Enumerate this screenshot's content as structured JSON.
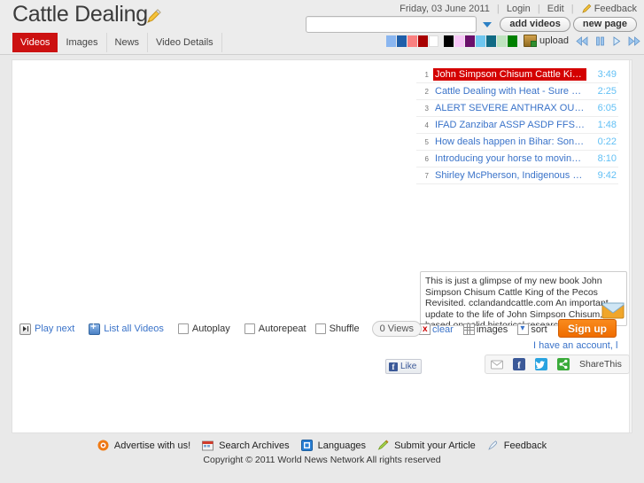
{
  "header": {
    "title": "Cattle Dealing",
    "edit_icon": "pencil-icon",
    "date": "Friday, 03 June 2011",
    "login": "Login",
    "edit": "Edit",
    "feedback": "Feedback",
    "search_value": "",
    "search_placeholder": "",
    "dropdown_icon": "chevron-down-icon",
    "add_videos": "add videos",
    "new_page": "new page"
  },
  "tabs": [
    {
      "label": "Videos",
      "active": true
    },
    {
      "label": "Images",
      "active": false
    },
    {
      "label": "News",
      "active": false
    },
    {
      "label": "Video Details",
      "active": false
    }
  ],
  "toolbar": {
    "swatches": [
      "#8ab6f0",
      "#1f5fa9",
      "#f98080",
      "#a80000",
      "#ffffff",
      "#000000",
      "#f7c7f7",
      "#6b0f6b",
      "#6ec6ef",
      "#116b85",
      "#bfe3bf",
      "#008000"
    ],
    "upload_label": "upload",
    "upload_icon": "upload-icon",
    "controls": [
      {
        "name": "rewind-icon",
        "glyph": "◀◀"
      },
      {
        "name": "pause-icon",
        "glyph": "▐▐"
      },
      {
        "name": "play-icon",
        "glyph": "▶"
      },
      {
        "name": "fast-forward-icon",
        "glyph": "▶▶"
      }
    ]
  },
  "playlist": [
    {
      "num": "1",
      "title": "John Simpson Chisum Cattle King o...",
      "duration": "3:49",
      "active": true
    },
    {
      "num": "2",
      "title": "Cattle Dealing with Heat - Sure Chi...",
      "duration": "2:25",
      "active": false
    },
    {
      "num": "3",
      "title": "ALERT SEVERE ANTHRAX OUTBREAK...",
      "duration": "6:05",
      "active": false
    },
    {
      "num": "4",
      "title": "IFAD Zanzibar ASSP ASDP FFS cattl...",
      "duration": "1:48",
      "active": false
    },
    {
      "num": "5",
      "title": "How deals happen in Bihar: Sonep...",
      "duration": "0:22",
      "active": false
    },
    {
      "num": "6",
      "title": "Introducing your horse to moving c...",
      "duration": "8:10",
      "active": false
    },
    {
      "num": "7",
      "title": "Shirley McPherson, Indigenous Lar...",
      "duration": "9:42",
      "active": false
    }
  ],
  "description": {
    "text": "This is just a glimpse of my new book John Simpson Chisum Cattle King of the Pecos Revisited. cclandandcattle.com An important update to the life of John Simpson Chisum, based on solid historical research and dealing with people and events",
    "envelope_icon": "envelope-icon"
  },
  "meta_row": {
    "clear": "clear",
    "images": "images",
    "sort": "sort"
  },
  "signup": {
    "button": "Sign up",
    "have_account": "I have an account, l"
  },
  "controls": {
    "play_next": "Play next",
    "list_all": "List all Videos",
    "autoplay": "Autoplay",
    "autorepeat": "Autorepeat",
    "shuffle": "Shuffle",
    "views": "0 Views"
  },
  "social": {
    "like": "Like",
    "share_this": "ShareThis",
    "icons": [
      "email-icon",
      "facebook-icon",
      "twitter-icon",
      "sharethis-icon"
    ]
  },
  "footer": {
    "links": [
      {
        "label": "Advertise with us!",
        "icon": "advertise-icon"
      },
      {
        "label": "Search Archives",
        "icon": "archives-icon"
      },
      {
        "label": "Languages",
        "icon": "languages-icon"
      },
      {
        "label": "Submit your Article",
        "icon": "submit-article-icon"
      },
      {
        "label": "Feedback",
        "icon": "feedback-pen-icon"
      }
    ],
    "copyright": "Copyright © 2011 World News Network All rights reserved"
  },
  "colors": {
    "accent_red": "#cc1111",
    "active_item_red": "#d40000",
    "link_blue": "#3a73c9",
    "duration_blue": "#62c0f5",
    "signup_orange": "#ef6c00"
  }
}
